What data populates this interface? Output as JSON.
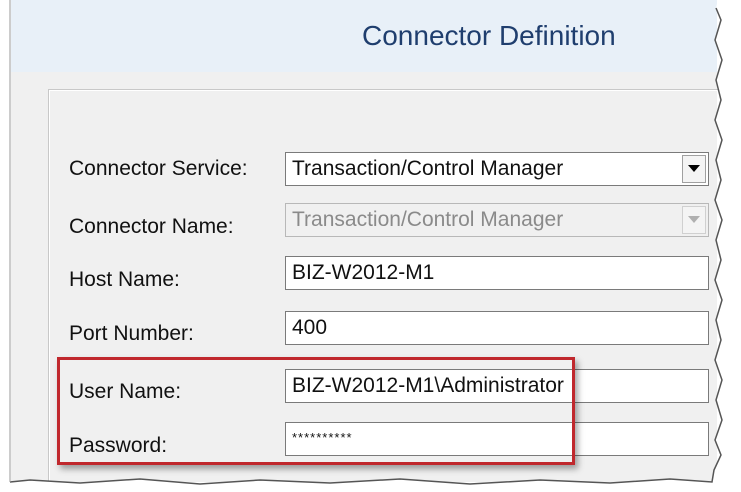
{
  "dialog": {
    "title": "Connector Definition"
  },
  "form": {
    "connector_service": {
      "label": "Connector Service:",
      "value": "Transaction/Control Manager"
    },
    "connector_name": {
      "label": "Connector Name:",
      "value": "Transaction/Control Manager"
    },
    "host_name": {
      "label": "Host Name:",
      "value": "BIZ-W2012-M1"
    },
    "port_number": {
      "label": "Port Number:",
      "value": "400"
    },
    "user_name": {
      "label": "User Name:",
      "value": "BIZ-W2012-M1\\Administrator"
    },
    "password": {
      "label": "Password:",
      "value": "**********"
    }
  },
  "colors": {
    "highlight_border": "#c0282d",
    "title_text": "#1f3e6e"
  }
}
